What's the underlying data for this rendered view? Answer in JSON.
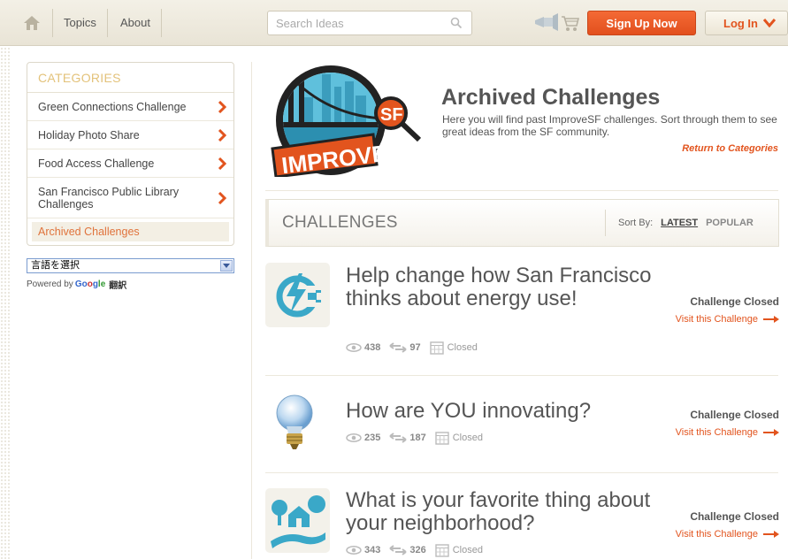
{
  "header": {
    "nav_topics": "Topics",
    "nav_about": "About",
    "search_placeholder": "Search Ideas",
    "signup_label": "Sign Up Now",
    "login_label": "Log In"
  },
  "sidebar": {
    "categories_title": "CATEGORIES",
    "items": [
      {
        "label": "Green Connections Challenge"
      },
      {
        "label": "Holiday Photo Share"
      },
      {
        "label": "Food Access Challenge"
      },
      {
        "label": "San Francisco Public Library Challenges"
      },
      {
        "label": "Archived Challenges"
      }
    ],
    "language_select": "言語を選択",
    "powered_by": "Powered by",
    "google_parts": [
      "Go",
      "o",
      "g",
      "le"
    ],
    "translate_label": "翻訳"
  },
  "main": {
    "logo_text": "IMPROVE",
    "logo_badge": "SF",
    "title": "Archived Challenges",
    "description": "Here you will find past ImproveSF challenges. Sort through them to see great ideas from the SF community.",
    "return_link": "Return to Categories",
    "challenges_label": "CHALLENGES",
    "sort_by": "Sort By:",
    "sort_latest": "LATEST",
    "sort_popular": "POPULAR"
  },
  "challenges": [
    {
      "title": "Help change how San Francisco thinks about energy use!",
      "views": "438",
      "shares": "97",
      "date_status": "Closed",
      "status": "Challenge Closed",
      "visit": "Visit this Challenge",
      "icon": "energy-plug-icon"
    },
    {
      "title": "How are YOU innovating?",
      "views": "235",
      "shares": "187",
      "date_status": "Closed",
      "status": "Challenge Closed",
      "visit": "Visit this Challenge",
      "icon": "lightbulb-icon"
    },
    {
      "title": "What is your favorite thing about your neighborhood?",
      "views": "343",
      "shares": "326",
      "date_status": "Closed",
      "status": "Challenge Closed",
      "visit": "Visit this Challenge",
      "icon": "neighborhood-icon"
    }
  ],
  "colors": {
    "accent_orange": "#e2541e",
    "category_title": "#e3c27a",
    "brand_teal": "#3aa8c8"
  }
}
